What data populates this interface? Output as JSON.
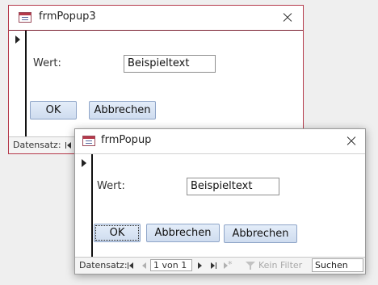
{
  "windows": [
    {
      "title": "frmPopup3",
      "field_label": "Wert:",
      "field_value": "Beispieltext",
      "ok_label": "OK",
      "cancel_label": "Abbrechen",
      "nav": {
        "record_label": "Datensatz:"
      }
    },
    {
      "title": "frmPopup",
      "field_label": "Wert:",
      "field_value": "Beispieltext",
      "ok_label": "OK",
      "cancel_label": "Abbrechen",
      "nav": {
        "record_label": "Datensatz:",
        "position": "1 von 1",
        "filter_label": "Kein Filter",
        "search_value": "Suchen"
      }
    }
  ],
  "colors": {
    "active_border": "#b5394a",
    "inactive_border": "#9a9a9a",
    "button_gradient_top": "#e4edf9",
    "button_gradient_bottom": "#cfdcef"
  },
  "icons": [
    "form-icon",
    "close-icon",
    "record-selector-arrow-icon",
    "nav-first-icon",
    "nav-prev-icon",
    "nav-next-icon",
    "nav-last-icon",
    "nav-new-icon",
    "filter-icon"
  ]
}
